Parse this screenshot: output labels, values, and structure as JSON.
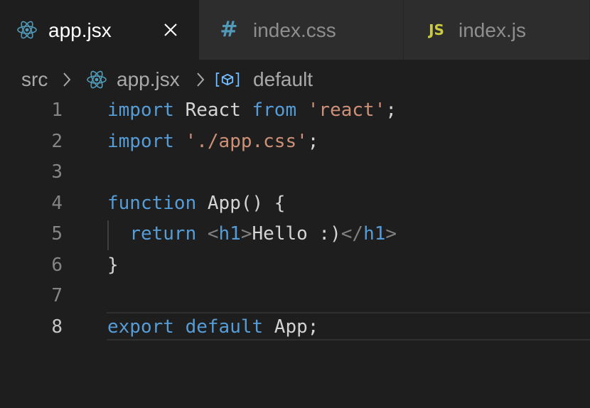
{
  "tabs": [
    {
      "label": "app.jsx",
      "icon": "react-icon",
      "active": true
    },
    {
      "label": "index.css",
      "icon": "css-hash-icon",
      "icon_text": "#",
      "active": false
    },
    {
      "label": "index.js",
      "icon": "javascript-icon",
      "icon_text": "JS",
      "active": false
    }
  ],
  "breadcrumb": {
    "folder": "src",
    "file": "app.jsx",
    "symbol": "default"
  },
  "code": {
    "line_numbers": [
      "1",
      "2",
      "3",
      "4",
      "5",
      "6",
      "7",
      "8"
    ],
    "lines": [
      [
        {
          "t": "import",
          "c": "kw"
        },
        {
          "t": " React ",
          "c": "plain"
        },
        {
          "t": "from",
          "c": "kw"
        },
        {
          "t": " ",
          "c": "plain"
        },
        {
          "t": "'react'",
          "c": "str"
        },
        {
          "t": ";",
          "c": "plain"
        }
      ],
      [
        {
          "t": "import",
          "c": "kw"
        },
        {
          "t": " ",
          "c": "plain"
        },
        {
          "t": "'./app.css'",
          "c": "str"
        },
        {
          "t": ";",
          "c": "plain"
        }
      ],
      [],
      [
        {
          "t": "function",
          "c": "kw"
        },
        {
          "t": " App() {",
          "c": "plain"
        }
      ],
      [
        {
          "t": "  ",
          "c": "plain"
        },
        {
          "t": "return",
          "c": "kw"
        },
        {
          "t": " ",
          "c": "plain"
        },
        {
          "t": "<",
          "c": "punct"
        },
        {
          "t": "h1",
          "c": "tag"
        },
        {
          "t": ">",
          "c": "punct"
        },
        {
          "t": "Hello :)",
          "c": "plain"
        },
        {
          "t": "</",
          "c": "punct"
        },
        {
          "t": "h1",
          "c": "tag"
        },
        {
          "t": ">",
          "c": "punct"
        }
      ],
      [
        {
          "t": "}",
          "c": "plain"
        }
      ],
      [],
      [
        {
          "t": "export",
          "c": "kw"
        },
        {
          "t": " ",
          "c": "plain"
        },
        {
          "t": "default",
          "c": "kw"
        },
        {
          "t": " App;",
          "c": "plain"
        }
      ]
    ],
    "current_line": 8
  },
  "colors": {
    "editor_bg": "#1e1e1e",
    "tabbar_bg": "#252526",
    "keyword": "#569cd6",
    "string": "#ce9178",
    "react_icon": "#519aba",
    "js_icon": "#cbcb41"
  }
}
